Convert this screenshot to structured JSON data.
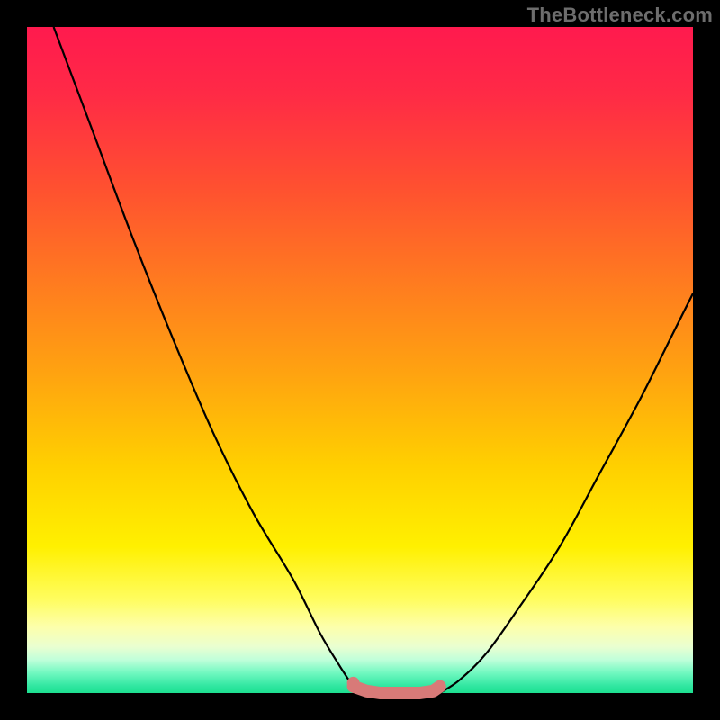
{
  "watermark": "TheBottleneck.com",
  "chart_data": {
    "type": "line",
    "title": "",
    "xlabel": "",
    "ylabel": "",
    "xlim": [
      0,
      100
    ],
    "ylim": [
      0,
      100
    ],
    "series": [
      {
        "name": "left-curve",
        "x": [
          4,
          10,
          16,
          22,
          28,
          34,
          40,
          44,
          47,
          49,
          50
        ],
        "y": [
          100,
          84,
          68,
          53,
          39,
          27,
          17,
          9,
          4,
          1,
          0
        ]
      },
      {
        "name": "right-curve",
        "x": [
          62,
          65,
          69,
          74,
          80,
          86,
          92,
          97,
          100
        ],
        "y": [
          0,
          2,
          6,
          13,
          22,
          33,
          44,
          54,
          60
        ]
      },
      {
        "name": "bottom-band",
        "x": [
          49,
          51,
          53,
          55,
          57,
          59,
          61,
          62
        ],
        "y": [
          1,
          0.3,
          0,
          0,
          0,
          0,
          0.3,
          1
        ]
      }
    ],
    "annotations": [
      {
        "type": "dot",
        "x": 49,
        "y": 1.5
      }
    ],
    "colors": {
      "curve": "#000000",
      "band": "#d87a78",
      "dot": "#d87a78"
    }
  }
}
